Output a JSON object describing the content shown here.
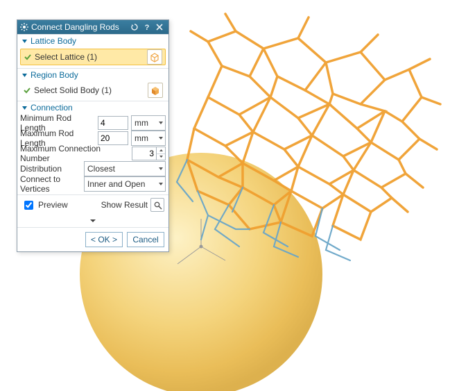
{
  "dialog": {
    "title": "Connect Dangling Rods",
    "sections": {
      "lattice": {
        "header": "Lattice Body",
        "select_label": "Select Lattice (1)"
      },
      "region": {
        "header": "Region Body",
        "select_label": "Select Solid Body (1)"
      },
      "connection": {
        "header": "Connection",
        "min_rod_label": "Minimum Rod Length",
        "min_rod_value": "4",
        "min_rod_unit": "mm",
        "max_rod_label": "Maximum Rod Length",
        "max_rod_value": "20",
        "max_rod_unit": "mm",
        "max_conn_label": "Maximum Connection Number",
        "max_conn_value": "3",
        "distribution_label": "Distribution",
        "distribution_value": "Closest",
        "ctv_label": "Connect to Vertices",
        "ctv_value": "Inner and Open"
      }
    },
    "preview_label": "Preview",
    "show_result_label": "Show Result",
    "ok_label": "< OK >",
    "cancel_label": "Cancel"
  },
  "colors": {
    "accent": "#2c6a8a",
    "section": "#0a6a9a",
    "highlight": "#ffe9a6",
    "highlight_border": "#f2c040",
    "check": "#5aa03c",
    "cube_solid": "#e08a2c",
    "cube_wire": "#f0a84a",
    "sphere": "#f2c95e",
    "lattice": "#f0a030",
    "lattice_blue": "#6aa6c8"
  },
  "icons": {
    "gear": "gear-icon",
    "reset": "reset-icon",
    "help": "help-icon",
    "close": "close-icon",
    "disclosure": "disclosure-down-icon",
    "check": "check-icon",
    "lattice_cube": "lattice-cube-icon",
    "solid_cube": "solid-cube-icon",
    "dropdown": "dropdown-arrow-icon",
    "spinner_up": "spinner-up-icon",
    "spinner_down": "spinner-down-icon",
    "magnifier": "magnifier-icon",
    "collapse": "collapse-caret-icon"
  }
}
